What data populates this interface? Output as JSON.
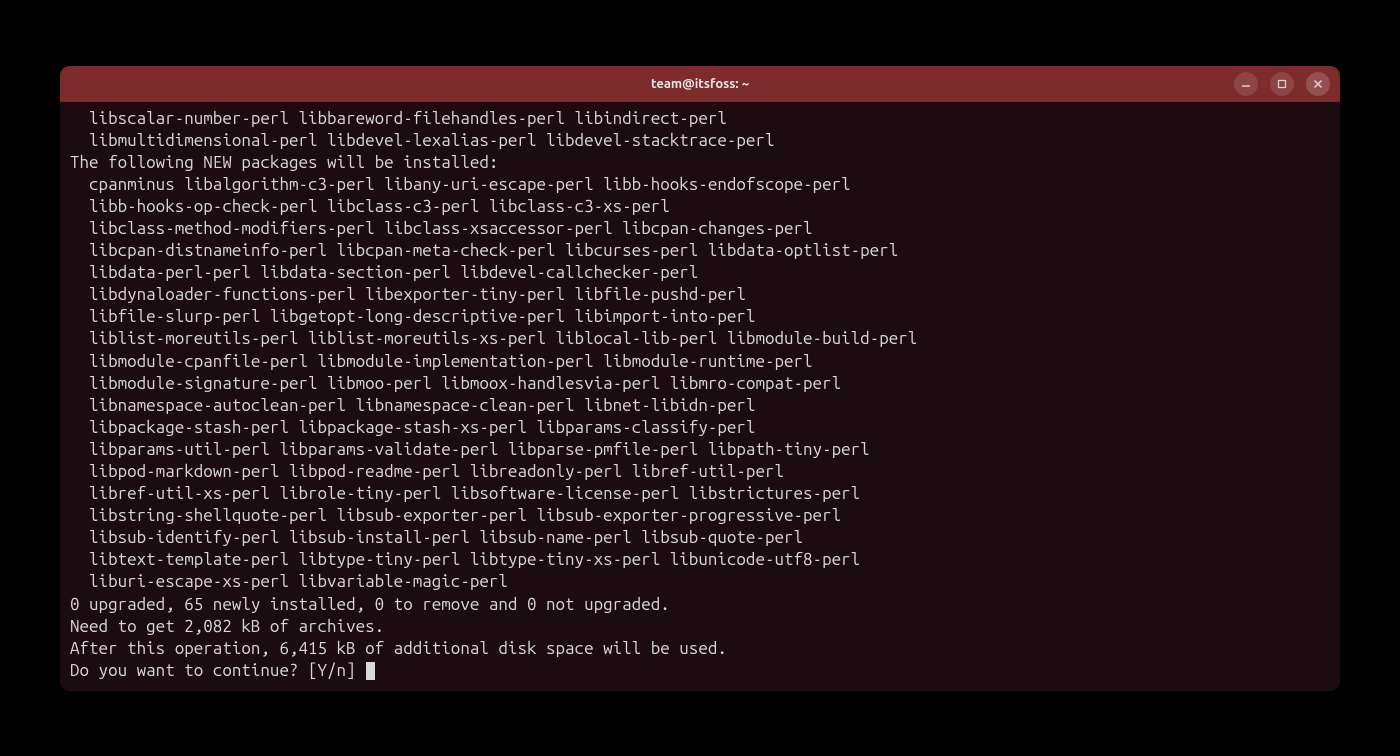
{
  "window": {
    "title": "team@itsfoss: ~"
  },
  "colors": {
    "titlebar": "#7d2b2b",
    "terminal_bg": "#1c0c12",
    "text": "#d8d8d8"
  },
  "terminal": {
    "lines": [
      "  libscalar-number-perl libbareword-filehandles-perl libindirect-perl",
      "  libmultidimensional-perl libdevel-lexalias-perl libdevel-stacktrace-perl",
      "The following NEW packages will be installed:",
      "  cpanminus libalgorithm-c3-perl libany-uri-escape-perl libb-hooks-endofscope-perl",
      "  libb-hooks-op-check-perl libclass-c3-perl libclass-c3-xs-perl",
      "  libclass-method-modifiers-perl libclass-xsaccessor-perl libcpan-changes-perl",
      "  libcpan-distnameinfo-perl libcpan-meta-check-perl libcurses-perl libdata-optlist-perl",
      "  libdata-perl-perl libdata-section-perl libdevel-callchecker-perl",
      "  libdynaloader-functions-perl libexporter-tiny-perl libfile-pushd-perl",
      "  libfile-slurp-perl libgetopt-long-descriptive-perl libimport-into-perl",
      "  liblist-moreutils-perl liblist-moreutils-xs-perl liblocal-lib-perl libmodule-build-perl",
      "  libmodule-cpanfile-perl libmodule-implementation-perl libmodule-runtime-perl",
      "  libmodule-signature-perl libmoo-perl libmoox-handlesvia-perl libmro-compat-perl",
      "  libnamespace-autoclean-perl libnamespace-clean-perl libnet-libidn-perl",
      "  libpackage-stash-perl libpackage-stash-xs-perl libparams-classify-perl",
      "  libparams-util-perl libparams-validate-perl libparse-pmfile-perl libpath-tiny-perl",
      "  libpod-markdown-perl libpod-readme-perl libreadonly-perl libref-util-perl",
      "  libref-util-xs-perl librole-tiny-perl libsoftware-license-perl libstrictures-perl",
      "  libstring-shellquote-perl libsub-exporter-perl libsub-exporter-progressive-perl",
      "  libsub-identify-perl libsub-install-perl libsub-name-perl libsub-quote-perl",
      "  libtext-template-perl libtype-tiny-perl libtype-tiny-xs-perl libunicode-utf8-perl",
      "  liburi-escape-xs-perl libvariable-magic-perl",
      "0 upgraded, 65 newly installed, 0 to remove and 0 not upgraded.",
      "Need to get 2,082 kB of archives.",
      "After this operation, 6,415 kB of additional disk space will be used.",
      "Do you want to continue? [Y/n] "
    ]
  }
}
